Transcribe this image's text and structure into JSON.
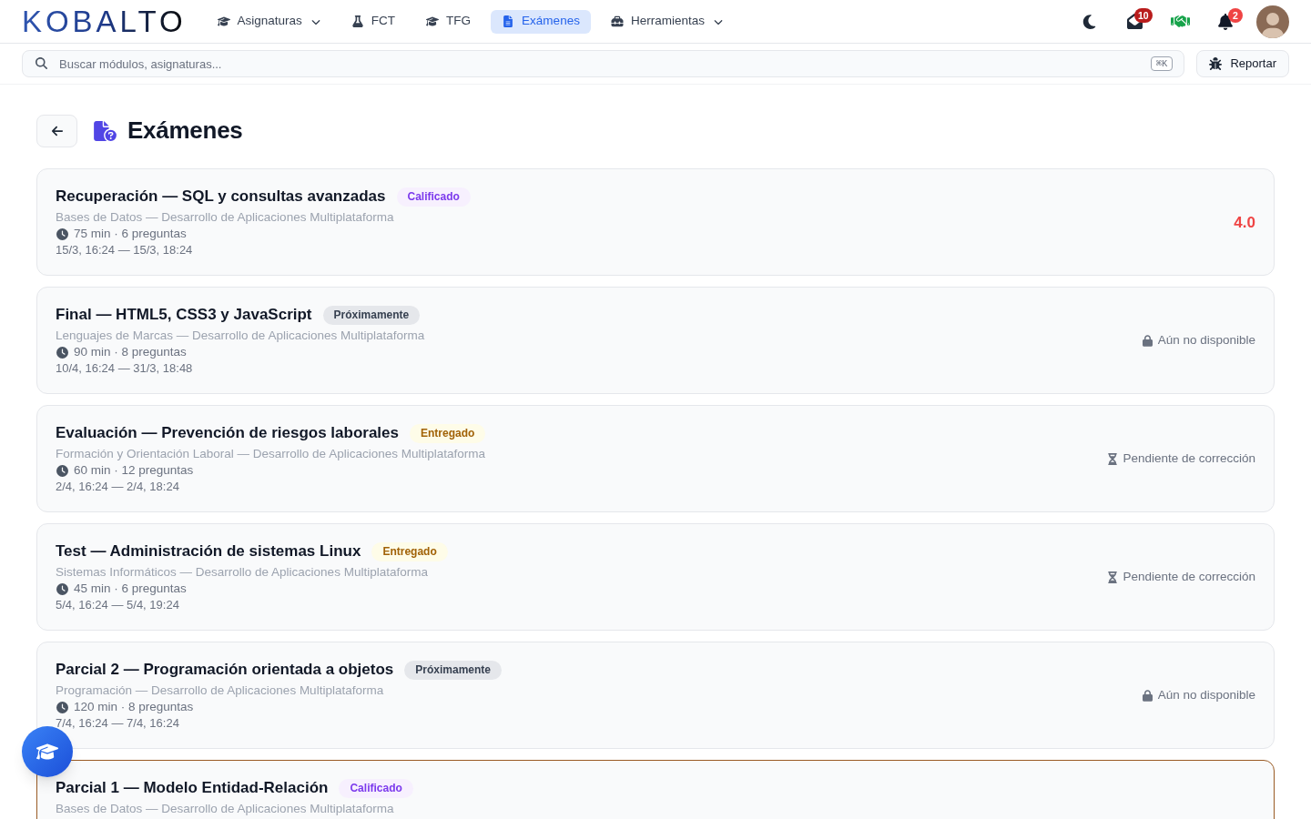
{
  "header": {
    "logo": "KOBALTO",
    "nav": [
      {
        "label": "Asignaturas",
        "has_menu": true,
        "selected": false
      },
      {
        "label": "FCT",
        "has_menu": false,
        "selected": false
      },
      {
        "label": "TFG",
        "has_menu": false,
        "selected": false
      },
      {
        "label": "Exámenes",
        "has_menu": false,
        "selected": true
      },
      {
        "label": "Herramientas",
        "has_menu": true,
        "selected": false
      }
    ],
    "actions": [
      {
        "kind": "theme"
      },
      {
        "kind": "messages",
        "badge": "10"
      },
      {
        "kind": "handshake"
      },
      {
        "kind": "notifications",
        "badge": "2"
      },
      {
        "kind": "avatar"
      }
    ]
  },
  "search": {
    "placeholder": "Buscar módulos, asignaturas...",
    "shortcut": "⌘K"
  },
  "report_button": "Reportar",
  "page": {
    "title": "Exámenes"
  },
  "exams": [
    {
      "title": "Recuperación — SQL y consultas avanzadas",
      "status": {
        "label": "Calificado",
        "kind": "graded"
      },
      "course": "Bases de Datos — Desarrollo de Aplicaciones Multiplataforma",
      "meta": "75 min · 6 preguntas",
      "dates": "15/3, 16:24 — 15/3, 18:24",
      "result": {
        "kind": "grade",
        "text": "4.0",
        "passed": false
      },
      "highlighted": false
    },
    {
      "title": "Final — HTML5, CSS3 y JavaScript",
      "status": {
        "label": "Próximamente",
        "kind": "upcoming"
      },
      "course": "Lenguajes de Marcas — Desarrollo de Aplicaciones Multiplataforma",
      "meta": "90 min · 8 preguntas",
      "dates": "10/4, 16:24 — 31/3, 18:48",
      "result": {
        "kind": "locked",
        "text": "Aún no disponible"
      },
      "highlighted": false
    },
    {
      "title": "Evaluación — Prevención de riesgos laborales",
      "status": {
        "label": "Entregado",
        "kind": "submitted"
      },
      "course": "Formación y Orientación Laboral — Desarrollo de Aplicaciones Multiplataforma",
      "meta": "60 min · 12 preguntas",
      "dates": "2/4, 16:24 — 2/4, 18:24",
      "result": {
        "kind": "pending",
        "text": "Pendiente de corrección"
      },
      "highlighted": false
    },
    {
      "title": "Test — Administración de sistemas Linux",
      "status": {
        "label": "Entregado",
        "kind": "submitted"
      },
      "course": "Sistemas Informáticos — Desarrollo de Aplicaciones Multiplataforma",
      "meta": "45 min · 6 preguntas",
      "dates": "5/4, 16:24 — 5/4, 19:24",
      "result": {
        "kind": "pending",
        "text": "Pendiente de corrección"
      },
      "highlighted": false
    },
    {
      "title": "Parcial 2 — Programación orientada a objetos",
      "status": {
        "label": "Próximamente",
        "kind": "upcoming"
      },
      "course": "Programación — Desarrollo de Aplicaciones Multiplataforma",
      "meta": "120 min · 8 preguntas",
      "dates": "7/4, 16:24 — 7/4, 16:24",
      "result": {
        "kind": "locked",
        "text": "Aún no disponible"
      },
      "highlighted": false
    },
    {
      "title": "Parcial 1 — Modelo Entidad-Relación",
      "status": {
        "label": "Calificado",
        "kind": "graded"
      },
      "course": "Bases de Datos — Desarrollo de Aplicaciones Multiplataforma",
      "highlighted": true
    }
  ]
}
